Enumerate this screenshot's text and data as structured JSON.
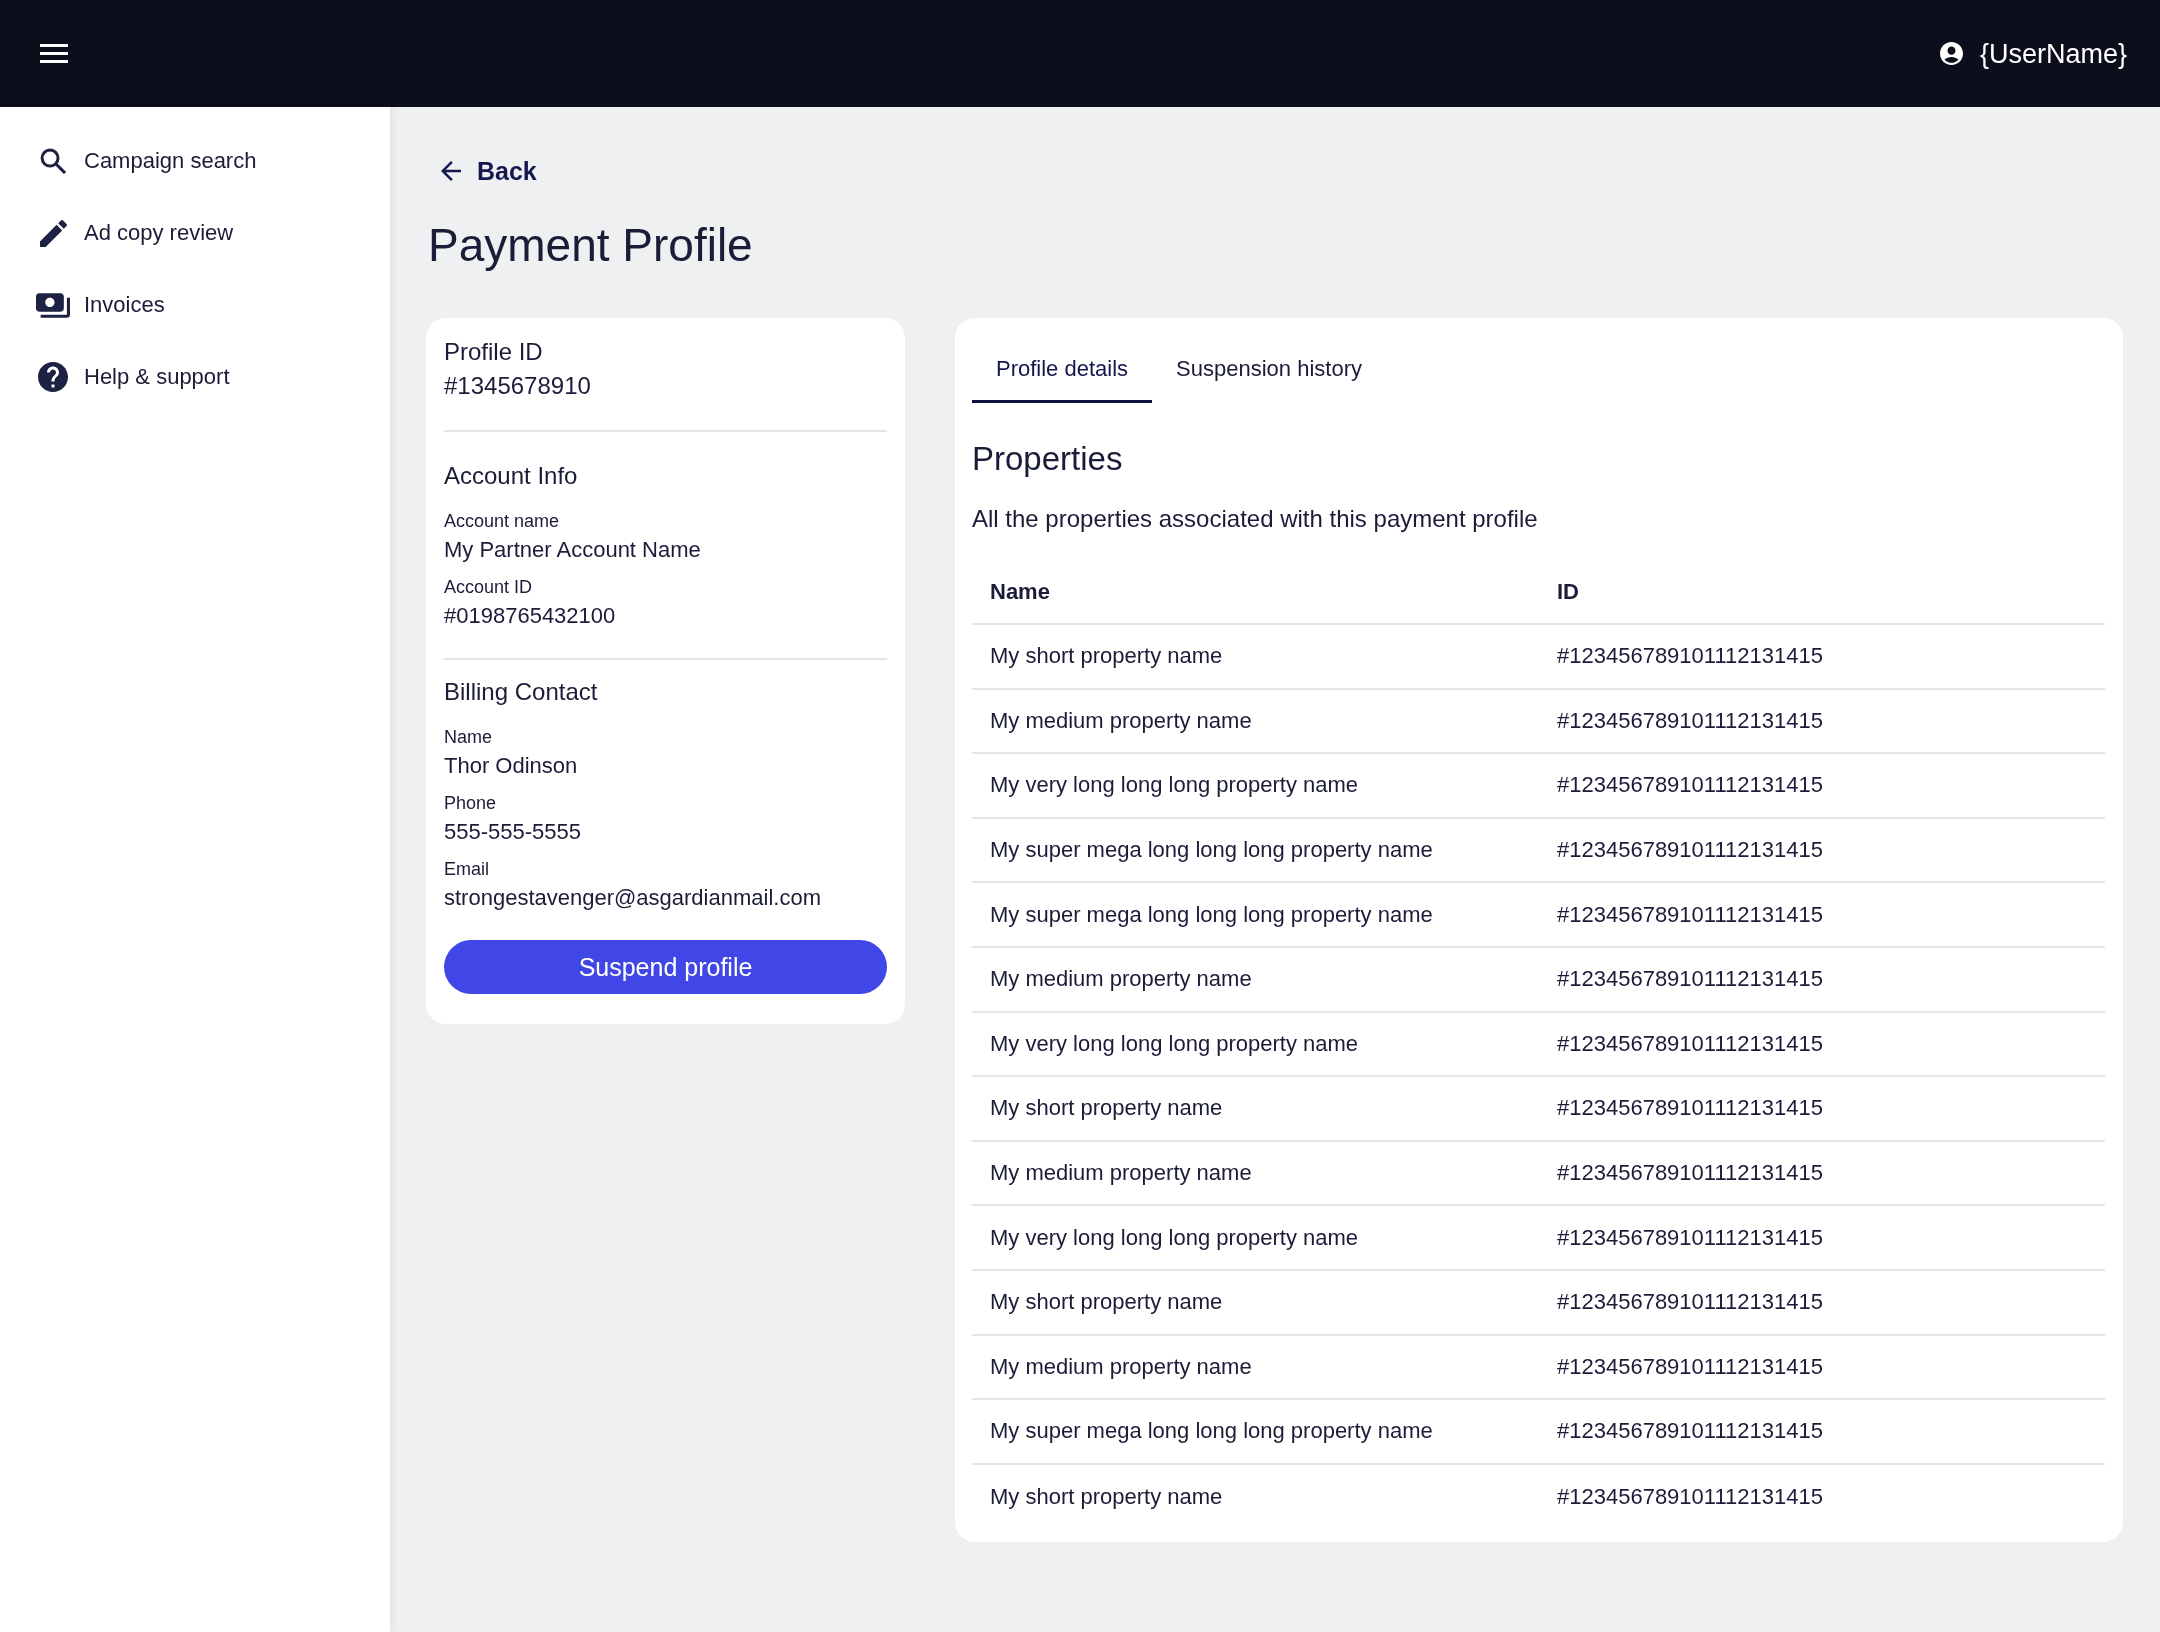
{
  "top_bar": {
    "user_name": "{UserName}"
  },
  "sidebar": {
    "items": [
      {
        "label": "Campaign search"
      },
      {
        "label": "Ad copy review"
      },
      {
        "label": "Invoices"
      },
      {
        "label": "Help & support"
      }
    ]
  },
  "page": {
    "back_link": "Back",
    "title": "Payment Profile"
  },
  "profile_card": {
    "profile_id": {
      "label": "Profile ID",
      "value": "#1345678910"
    },
    "sections": [
      {
        "heading": "Account Info",
        "fields": [
          {
            "label": "Account name",
            "value": "My Partner Account Name"
          },
          {
            "label": "Account ID",
            "value": "#0198765432100"
          }
        ]
      },
      {
        "heading": "Billing Contact",
        "fields": [
          {
            "label": "Name",
            "value": "Thor Odinson"
          },
          {
            "label": "Phone",
            "value": "555-555-5555"
          },
          {
            "label": "Email",
            "value": "strongestavenger@asgardianmail.com"
          }
        ]
      }
    ],
    "button": "Suspend profile"
  },
  "details_card": {
    "tabs": [
      {
        "label": "Profile details",
        "selected": true
      },
      {
        "label": "Suspension history",
        "selected": false
      }
    ],
    "heading": "Properties",
    "description": "All the properties associated with this payment profile",
    "table": {
      "columns": [
        "Name",
        "ID"
      ],
      "rows": [
        [
          "My short property name",
          "#123456789101112131415"
        ],
        [
          "My medium property name",
          "#123456789101112131415"
        ],
        [
          "My very long long long property name",
          "#123456789101112131415"
        ],
        [
          "My super mega long long long property name",
          "#123456789101112131415"
        ],
        [
          "My super mega long long long property name",
          "#123456789101112131415"
        ],
        [
          "My medium property name",
          "#123456789101112131415"
        ],
        [
          "My very long long long property name",
          "#123456789101112131415"
        ],
        [
          "My short property name",
          "#123456789101112131415"
        ],
        [
          "My medium property name",
          "#123456789101112131415"
        ],
        [
          "My very long long long property name",
          "#123456789101112131415"
        ],
        [
          "My short property name",
          "#123456789101112131415"
        ],
        [
          "My medium property name",
          "#123456789101112131415"
        ],
        [
          "My super mega long long long property name",
          "#123456789101112131415"
        ],
        [
          "My short property name",
          "#123456789101112131415"
        ]
      ]
    }
  }
}
